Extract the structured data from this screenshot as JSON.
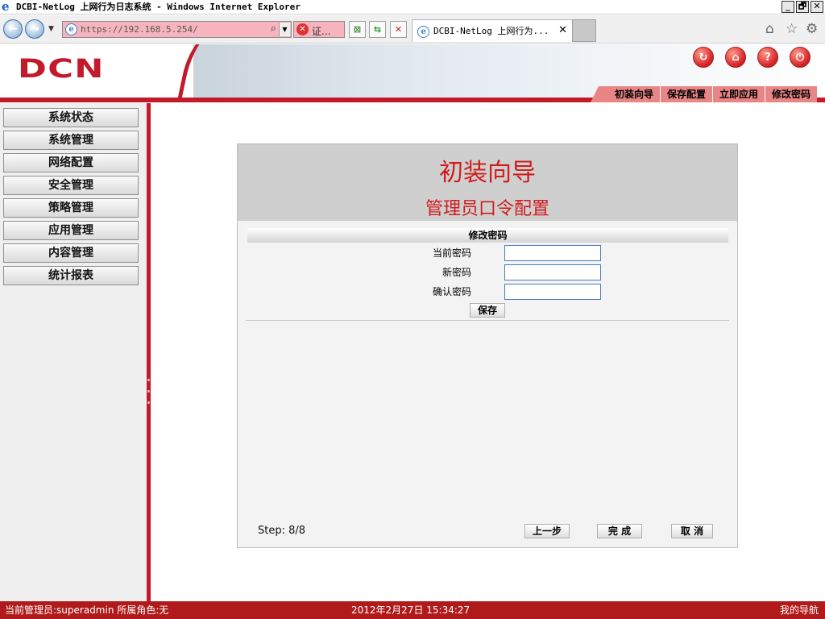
{
  "window": {
    "title": "DCBI-NetLog 上网行为日志系统 - Windows Internet Explorer",
    "controls": [
      "_",
      "🗗",
      "✕"
    ]
  },
  "browser": {
    "address": "https://192.168.5.254/",
    "cert_label": "证...",
    "tab_title": "DCBI-NetLog 上网行为...",
    "tab_close": "✕"
  },
  "header": {
    "logo": "DCN",
    "quick_menu": [
      "初装向导",
      "保存配置",
      "立即应用",
      "修改密码"
    ]
  },
  "sidebar": {
    "items": [
      "系统状态",
      "系统管理",
      "网络配置",
      "安全管理",
      "策略管理",
      "应用管理",
      "内容管理",
      "统计报表"
    ]
  },
  "wizard": {
    "title": "初装向导",
    "subtitle": "管理员口令配置",
    "section_title": "修改密码",
    "fields": [
      {
        "label": "当前密码",
        "value": ""
      },
      {
        "label": "新密码",
        "value": ""
      },
      {
        "label": "确认密码",
        "value": ""
      }
    ],
    "save_label": "保存",
    "step": "Step: 8/8",
    "prev_label": "上一步",
    "finish_label": "完 成",
    "cancel_label": "取 消"
  },
  "statusbar": {
    "user_info": "当前管理员:superadmin  所属角色:无",
    "datetime": "2012年2月27日 15:34:27",
    "nav_link": "我的导航"
  },
  "colors": {
    "brand_red": "#c21a2a",
    "title_red": "#d01c1c",
    "statusbar_red": "#b01a1a",
    "address_bar_warning": "#f7b4be"
  }
}
